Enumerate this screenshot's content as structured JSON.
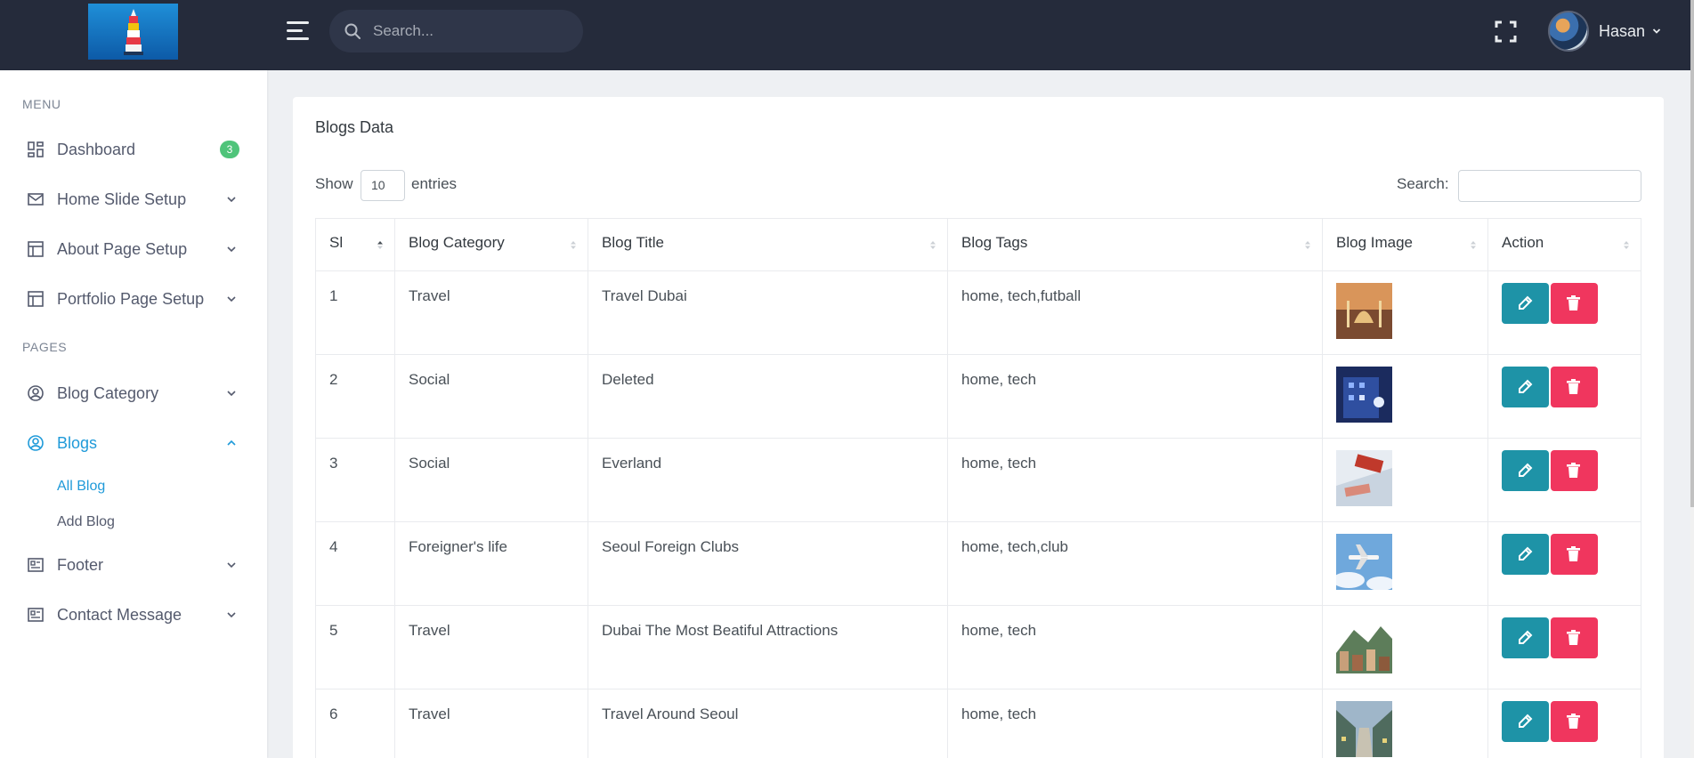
{
  "header": {
    "search_placeholder": "Search...",
    "user_name": "Hasan",
    "icons": [
      "hamburger-icon",
      "search-icon",
      "fullscreen-icon",
      "chevron-down-icon"
    ]
  },
  "sidebar": {
    "menu_title": "MENU",
    "pages_title": "PAGES",
    "items": [
      {
        "label": "Dashboard",
        "icon": "dashboard-icon",
        "badge": "3"
      },
      {
        "label": "Home Slide Setup",
        "icon": "mail-icon"
      },
      {
        "label": "About Page Setup",
        "icon": "layout-icon"
      },
      {
        "label": "Portfolio Page Setup",
        "icon": "layout-icon"
      },
      {
        "label": "Blog Category",
        "icon": "user-circle-icon"
      },
      {
        "label": "Blogs",
        "icon": "user-circle-icon",
        "active": true
      },
      {
        "label": "Footer",
        "icon": "newspaper-icon"
      },
      {
        "label": "Contact Message",
        "icon": "newspaper-icon"
      }
    ],
    "blog_sub": [
      {
        "label": "All Blog",
        "active": true
      },
      {
        "label": "Add Blog"
      }
    ]
  },
  "card": {
    "title": "Blogs Data",
    "show_label": "Show",
    "entries_value": "10",
    "entries_label": "entries",
    "search_label": "Search:"
  },
  "table": {
    "headers": [
      "Sl",
      "Blog Category",
      "Blog Title",
      "Blog Tags",
      "Blog Image",
      "Action"
    ],
    "rows": [
      {
        "sl": "1",
        "category": "Travel",
        "title": "Travel Dubai",
        "tags": "home, tech,futball",
        "image": "mosque-photo"
      },
      {
        "sl": "2",
        "category": "Social",
        "title": "Deleted",
        "tags": "home, tech",
        "image": "building-night-photo"
      },
      {
        "sl": "3",
        "category": "Social",
        "title": "Everland",
        "tags": "home, tech",
        "image": "stamp-photo"
      },
      {
        "sl": "4",
        "category": "Foreigner's life",
        "title": "Seoul Foreign Clubs",
        "tags": "home, tech,club",
        "image": "airplane-photo"
      },
      {
        "sl": "5",
        "category": "Travel",
        "title": "Dubai The Most Beatiful Attractions",
        "tags": "home, tech",
        "image": "city-mountain-photo"
      },
      {
        "sl": "6",
        "category": "Travel",
        "title": "Travel Around Seoul",
        "tags": "home, tech",
        "image": "street-photo"
      }
    ]
  },
  "colors": {
    "topbar": "#252b3b",
    "accent": "#1f9ad9",
    "edit_button": "#1e93a7",
    "delete_button": "#f0365e",
    "badge": "#4fc47a"
  }
}
